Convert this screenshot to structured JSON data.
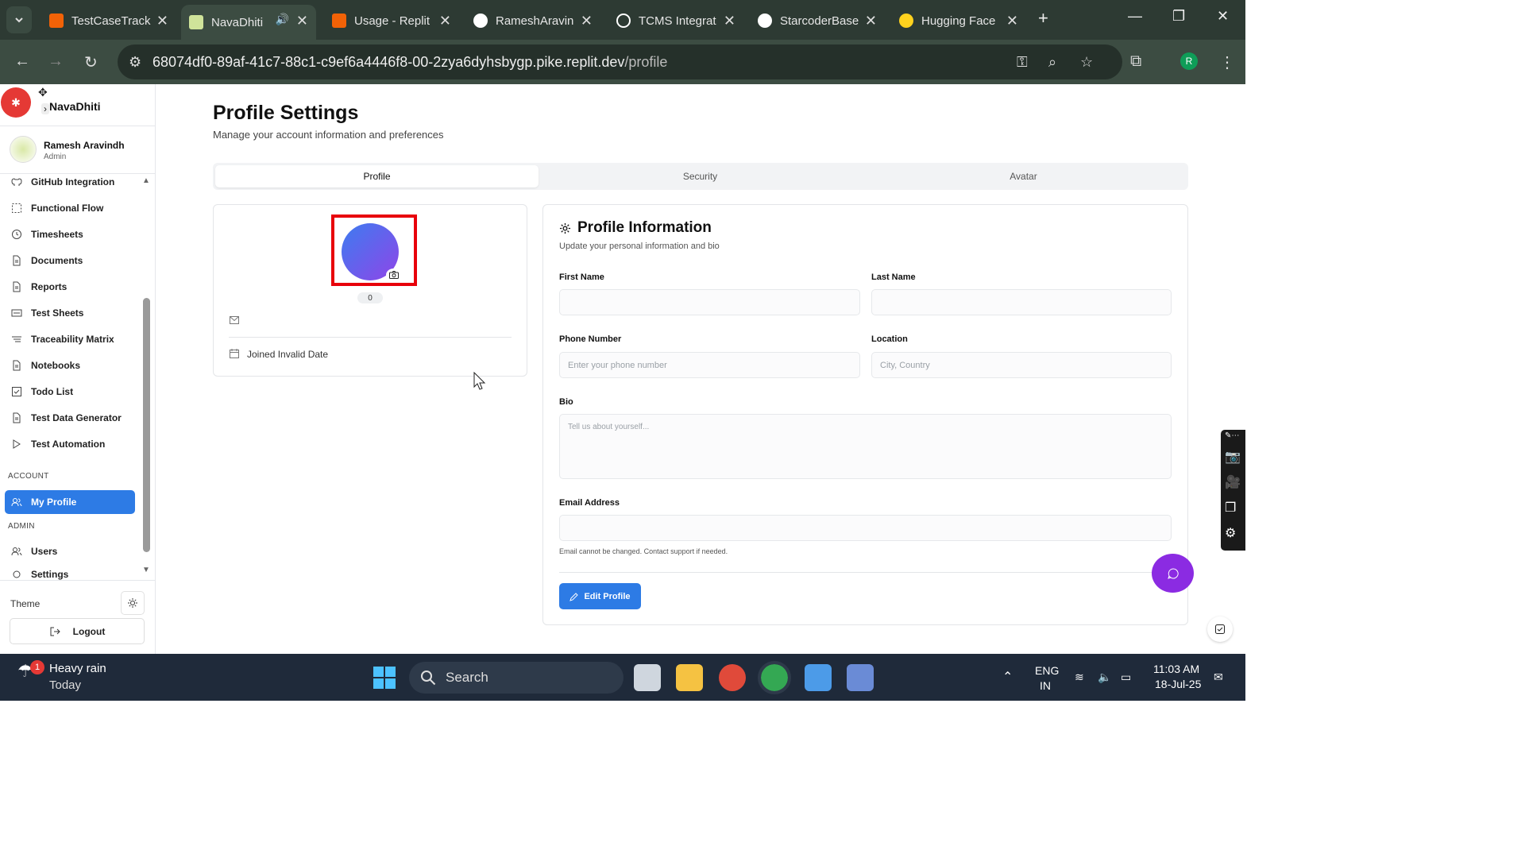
{
  "browser": {
    "tabs": [
      {
        "title": "TestCaseTrack",
        "color": "#f26207"
      },
      {
        "title": "NavaDhiti",
        "color": "#cfe39a"
      },
      {
        "title": "Usage - Replit",
        "color": "#f26207"
      },
      {
        "title": "RameshAravin",
        "color": "#ffffff"
      },
      {
        "title": "TCMS Integrat",
        "color": "#ffffff"
      },
      {
        "title": "StarcoderBase",
        "color": "#ffffff"
      },
      {
        "title": "Hugging Face",
        "color": "#ffd21e"
      }
    ],
    "url_host": "68074df0-89af-41c7-88c1-c9ef6a4446f8-00-2zya6dyhsbygp.pike.replit.dev",
    "url_path": "/profile",
    "profile_initial": "R"
  },
  "sidebar": {
    "brand": "NavaDhiti",
    "user_name": "Ramesh Aravindh",
    "user_role": "Admin",
    "items": [
      {
        "label": "GitHub Integration",
        "icon": "github-icon"
      },
      {
        "label": "Functional Flow",
        "icon": "flow-icon"
      },
      {
        "label": "Timesheets",
        "icon": "clock-icon"
      },
      {
        "label": "Documents",
        "icon": "document-icon"
      },
      {
        "label": "Reports",
        "icon": "report-icon"
      },
      {
        "label": "Test Sheets",
        "icon": "sheet-icon"
      },
      {
        "label": "Traceability Matrix",
        "icon": "matrix-icon"
      },
      {
        "label": "Notebooks",
        "icon": "notebook-icon"
      },
      {
        "label": "Todo List",
        "icon": "checkbox-icon"
      },
      {
        "label": "Test Data Generator",
        "icon": "data-icon"
      },
      {
        "label": "Test Automation",
        "icon": "play-icon"
      }
    ],
    "account_section": "ACCOUNT",
    "my_profile": "My Profile",
    "admin_section": "ADMIN",
    "users": "Users",
    "settings": "Settings",
    "theme_label": "Theme",
    "logout": "Logout"
  },
  "page": {
    "title": "Profile Settings",
    "subtitle": "Manage your account information and preferences",
    "tabs": [
      "Profile",
      "Security",
      "Avatar"
    ],
    "active_tab": "Profile"
  },
  "profile_card": {
    "badge": "0",
    "joined": "Joined Invalid Date"
  },
  "info": {
    "title": "Profile Information",
    "subtitle": "Update your personal information and bio",
    "first_name_label": "First Name",
    "last_name_label": "Last Name",
    "phone_label": "Phone Number",
    "phone_placeholder": "Enter your phone number",
    "location_label": "Location",
    "location_placeholder": "City, Country",
    "bio_label": "Bio",
    "bio_placeholder": "Tell us about yourself...",
    "email_label": "Email Address",
    "email_hint": "Email cannot be changed. Contact support if needed.",
    "edit_button": "Edit Profile"
  },
  "taskbar": {
    "weather_title": "Heavy rain",
    "weather_sub": "Today",
    "notif_count": "1",
    "search": "Search",
    "lang1": "ENG",
    "lang2": "IN",
    "time": "11:03 AM",
    "date": "18-Jul-25"
  }
}
